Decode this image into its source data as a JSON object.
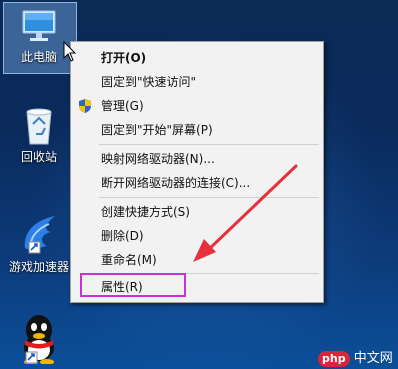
{
  "desktop": {
    "icons": [
      {
        "label": "此电脑",
        "icon": "computer-icon"
      },
      {
        "label": "回收站",
        "icon": "recycle-bin-icon"
      },
      {
        "label": "游戏加速器",
        "icon": "game-accelerator-icon"
      },
      {
        "label": "",
        "icon": "qq-penguin-icon"
      }
    ]
  },
  "context_menu": {
    "items": [
      {
        "label": "打开(O)",
        "bold": true
      },
      {
        "label": "固定到\"快速访问\""
      },
      {
        "label": "管理(G)",
        "icon": "uac-shield-icon"
      },
      {
        "label": "固定到\"开始\"屏幕(P)"
      },
      {
        "label": "映射网络驱动器(N)..."
      },
      {
        "label": "断开网络驱动器的连接(C)..."
      },
      {
        "label": "创建快捷方式(S)"
      },
      {
        "label": "删除(D)"
      },
      {
        "label": "重命名(M)"
      },
      {
        "label": "属性(R)"
      }
    ]
  },
  "annotation": {
    "highlight_color": "#c832d8",
    "arrow_color": "#e8303a"
  },
  "watermark": {
    "brand": "php",
    "site": "中文网"
  }
}
